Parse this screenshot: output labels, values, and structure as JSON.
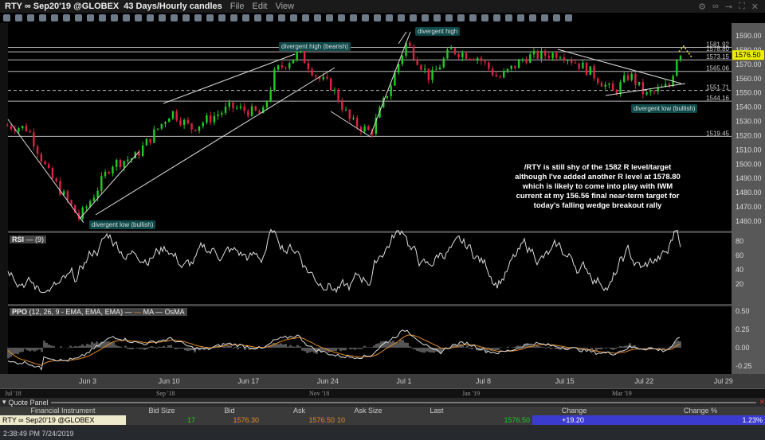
{
  "window": {
    "symbol": "RTY ∞ Sep20'19 @GLOBEX",
    "timeframe": "43 Days/Hourly candles",
    "menu": [
      "File",
      "Edit",
      "View"
    ]
  },
  "chart_data": {
    "type": "candlestick",
    "title": "RTY ∞ Sep20'19 @GLOBEX 43 Days/Hourly candles",
    "x_labels": [
      "Jun 3",
      "Jun 10",
      "Jun 17",
      "Jun 24",
      "Jul 1",
      "Jul 8",
      "Jul 15",
      "Jul 22",
      "Jul 29"
    ],
    "price_axis": [
      "1590.00",
      "1580.00",
      "1570.00",
      "1560.00",
      "1550.00",
      "1540.00",
      "1530.00",
      "1520.00",
      "1510.00",
      "1500.00",
      "1490.00",
      "1480.00",
      "1470.00",
      "1460.00"
    ],
    "ylim": [
      1455,
      1593
    ],
    "price_path_days_from_jun3": [
      [
        -6.9,
        1527
      ],
      [
        -5.1,
        1525
      ],
      [
        -3.4,
        1495
      ],
      [
        -0.6,
        1462
      ],
      [
        0.8,
        1480
      ],
      [
        2.2,
        1500
      ],
      [
        4.3,
        1505
      ],
      [
        7.5,
        1537
      ],
      [
        9.2,
        1525
      ],
      [
        12.7,
        1540
      ],
      [
        15.5,
        1535
      ],
      [
        16.6,
        1565
      ],
      [
        18.7,
        1578
      ],
      [
        20.4,
        1560
      ],
      [
        21.5,
        1555
      ],
      [
        23.2,
        1530
      ],
      [
        25.0,
        1522
      ],
      [
        26.7,
        1555
      ],
      [
        28.1,
        1585
      ],
      [
        30.2,
        1560
      ],
      [
        32.0,
        1580
      ],
      [
        34.4,
        1575
      ],
      [
        36.2,
        1560
      ],
      [
        38.6,
        1575
      ],
      [
        41.7,
        1578
      ],
      [
        44.2,
        1565
      ],
      [
        46.3,
        1550
      ],
      [
        47.7,
        1563
      ],
      [
        49.1,
        1548
      ],
      [
        51.2,
        1555
      ],
      [
        52.0,
        1580
      ],
      [
        52.4,
        1576.5
      ]
    ],
    "levels": [
      "1581.92",
      "1578.80",
      "1573.15",
      "1565.06",
      "1551.71",
      "1544.16",
      "1519.45"
    ],
    "last_price": "1576.50",
    "annotations": [
      "divergent high (bearish)",
      "divergent high",
      "divergent low (bullish)",
      "divergent low (bullish)"
    ],
    "note": [
      "/RTY is still shy of the 1582 R level/target",
      "although I've added another R level at 1578.80",
      "which is likely to come into play with IWM",
      "current at my 156.56 final near-term target for",
      "today's falling wedge breakout rally"
    ],
    "rsi": {
      "label": "RSI",
      "params": "(9)",
      "axis": [
        "80",
        "60",
        "40",
        "20"
      ]
    },
    "ppo": {
      "label": "PPO",
      "params": "(12, 26, 9 - EMA, EMA, EMA)",
      "ma": "MA",
      "osma": "OsMA",
      "axis": [
        "0.50",
        "0.25",
        "0.00",
        "-0.25"
      ]
    }
  },
  "scrollbar": [
    "Jul '18",
    "Sep '18",
    "Nov '18",
    "Jan '19",
    "Mar '19"
  ],
  "quote_panel": {
    "title": "Quote Panel",
    "headers": [
      "Financial Instrument",
      "Bid Size",
      "Bid",
      "Ask",
      "Ask Size",
      "Last",
      "Change",
      "Change %"
    ],
    "row": {
      "instrument": "RTY ∞ Sep20'19 @GLOBEX",
      "bid_size": "17",
      "bid": "1576.30",
      "ask": "1576.50",
      "ask_size": "10",
      "last": "1576.50",
      "change": "+19.20",
      "change_pct": "1.23%"
    }
  },
  "status": "2:38:49 PM 7/24/2019",
  "colors": {
    "up": "#22cc22",
    "down": "#dd2244",
    "level": "#bbbbbb",
    "change_bg": "#3b3bd0",
    "ma": "#e08a2a"
  }
}
